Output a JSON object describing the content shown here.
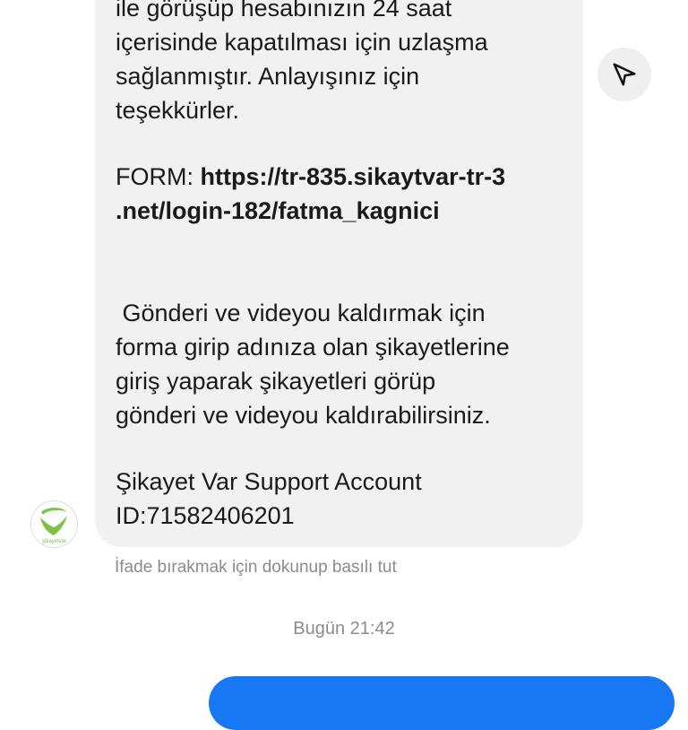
{
  "message": {
    "lines": [
      "ile görüşüp hesabınızın 24 saat",
      "içerisinde kapatılması için uzlaşma",
      "sağlanmıştır. Anlayışınız için",
      "teşekkürler.",
      "FORM: ",
      "https://tr-835.sikaytvar-tr-3",
      ".net/login-182/fatma_kagnici",
      " Gönderi ve videyou kaldırmak için",
      "forma girip adınıza olan şikayetlerine",
      "giriş yaparak şikayetleri görüp",
      "gönderi ve videyou kaldırabilirsiniz.",
      "Şikayet Var Support Account",
      "ID:71582406201"
    ]
  },
  "reaction_hint": "İfade bırakmak için dokunup basılı tut",
  "timestamp": "Bugün 21:42",
  "avatar": {
    "icon": "sikayetvar-logo-icon",
    "brand_text": "şikayetvar"
  },
  "share_button": {
    "icon": "send-arrow-icon"
  },
  "colors": {
    "bubble": "#f1f1f1",
    "outgoing": "#1877f2",
    "logo_green": "#7cc242",
    "meta_text": "#8c8c8c"
  }
}
